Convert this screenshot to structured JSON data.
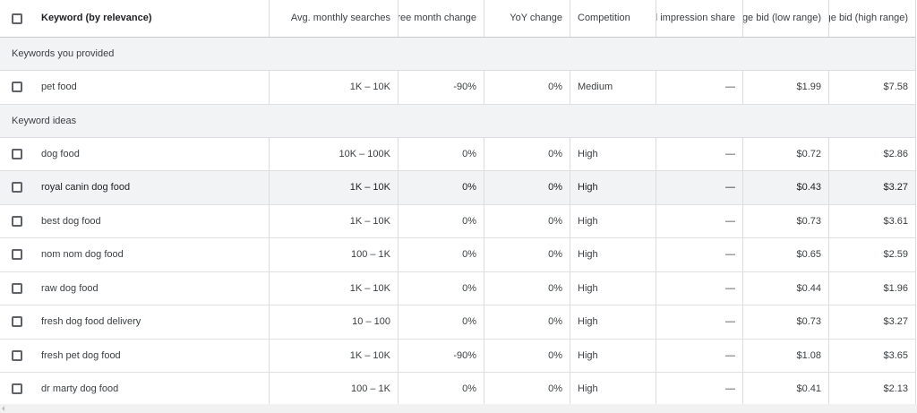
{
  "header": {
    "keyword": "Keyword (by relevance)",
    "avg_searches": "Avg. monthly searches",
    "three_month": "Three month change",
    "yoy": "YoY change",
    "competition": "Competition",
    "ad_impression": "Ad impression share",
    "bid_low": "Top of page bid (low range)",
    "bid_high": "Top of page bid (high range)"
  },
  "sections": {
    "provided": "Keywords you provided",
    "ideas": "Keyword ideas"
  },
  "provided_rows": [
    {
      "keyword": "pet food",
      "avg": "1K – 10K",
      "three": "-90%",
      "yoy": "0%",
      "comp": "Medium",
      "ad": "—",
      "low": "$1.99",
      "high": "$7.58"
    }
  ],
  "idea_rows": [
    {
      "keyword": "dog food",
      "avg": "10K – 100K",
      "three": "0%",
      "yoy": "0%",
      "comp": "High",
      "ad": "—",
      "low": "$0.72",
      "high": "$2.86"
    },
    {
      "keyword": "royal canin dog food",
      "avg": "1K – 10K",
      "three": "0%",
      "yoy": "0%",
      "comp": "High",
      "ad": "—",
      "low": "$0.43",
      "high": "$3.27"
    },
    {
      "keyword": "best dog food",
      "avg": "1K – 10K",
      "three": "0%",
      "yoy": "0%",
      "comp": "High",
      "ad": "—",
      "low": "$0.73",
      "high": "$3.61"
    },
    {
      "keyword": "nom nom dog food",
      "avg": "100 – 1K",
      "three": "0%",
      "yoy": "0%",
      "comp": "High",
      "ad": "—",
      "low": "$0.65",
      "high": "$2.59"
    },
    {
      "keyword": "raw dog food",
      "avg": "1K – 10K",
      "three": "0%",
      "yoy": "0%",
      "comp": "High",
      "ad": "—",
      "low": "$0.44",
      "high": "$1.96"
    },
    {
      "keyword": "fresh dog food delivery",
      "avg": "10 – 100",
      "three": "0%",
      "yoy": "0%",
      "comp": "High",
      "ad": "—",
      "low": "$0.73",
      "high": "$3.27"
    },
    {
      "keyword": "fresh pet dog food",
      "avg": "1K – 10K",
      "three": "-90%",
      "yoy": "0%",
      "comp": "High",
      "ad": "—",
      "low": "$1.08",
      "high": "$3.65"
    },
    {
      "keyword": "dr marty dog food",
      "avg": "100 – 1K",
      "three": "0%",
      "yoy": "0%",
      "comp": "High",
      "ad": "—",
      "low": "$0.41",
      "high": "$2.13"
    }
  ],
  "colors": {
    "section_bg": "#f1f3f4",
    "border": "#dadce0",
    "checkbox": "#5f6368"
  }
}
